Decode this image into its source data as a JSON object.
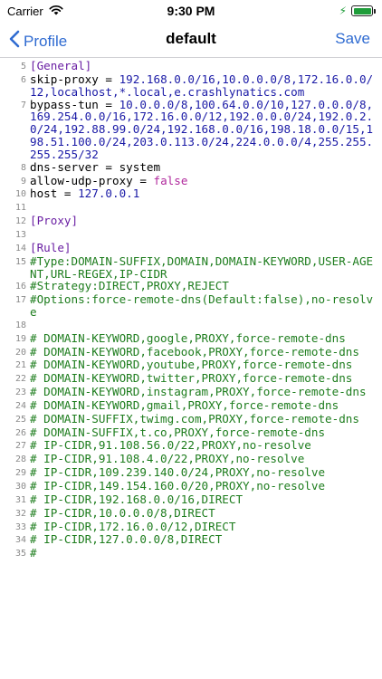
{
  "status_bar": {
    "carrier": "Carrier",
    "time": "9:30 PM",
    "battery_level": 1.0
  },
  "nav": {
    "back_label": "Profile",
    "title": "default",
    "save_label": "Save"
  },
  "colors": {
    "accent": "#2f6bd1",
    "section": "#6a1fa3",
    "value": "#1a1aa6",
    "boolean": "#b0289c",
    "comment": "#1e7d1e",
    "line_number": "#8a8a8a"
  },
  "lines": [
    {
      "num": "5",
      "type": "section",
      "text": "[General]"
    },
    {
      "num": "6",
      "type": "kv",
      "key": "skip-proxy = ",
      "value": "192.168.0.0/16,10.0.0.0/8,172.16.0.0/12,localhost,*.local,e.crashlynatics.com",
      "value_type": "value"
    },
    {
      "num": "7",
      "type": "kv",
      "key": "bypass-tun = ",
      "value": "10.0.0.0/8,100.64.0.0/10,127.0.0.0/8,169.254.0.0/16,172.16.0.0/12,192.0.0.0/24,192.0.2.0/24,192.88.99.0/24,192.168.0.0/16,198.18.0.0/15,198.51.100.0/24,203.0.113.0/24,224.0.0.0/4,255.255.255.255/32",
      "value_type": "value"
    },
    {
      "num": "8",
      "type": "kv",
      "key": "dns-server = system",
      "value": "",
      "value_type": "value"
    },
    {
      "num": "9",
      "type": "kv",
      "key": "allow-udp-proxy = ",
      "value": "false",
      "value_type": "boolean"
    },
    {
      "num": "10",
      "type": "kv",
      "key": "host = ",
      "value": "127.0.0.1",
      "value_type": "value"
    },
    {
      "num": "11",
      "type": "blank",
      "text": ""
    },
    {
      "num": "12",
      "type": "section",
      "text": "[Proxy]"
    },
    {
      "num": "13",
      "type": "blank",
      "text": ""
    },
    {
      "num": "14",
      "type": "section",
      "text": "[Rule]"
    },
    {
      "num": "15",
      "type": "comment",
      "text": "#Type:DOMAIN-SUFFIX,DOMAIN,DOMAIN-KEYWORD,USER-AGENT,URL-REGEX,IP-CIDR"
    },
    {
      "num": "16",
      "type": "comment",
      "text": "#Strategy:DIRECT,PROXY,REJECT"
    },
    {
      "num": "17",
      "type": "comment",
      "text": "#Options:force-remote-dns(Default:false),no-resolve"
    },
    {
      "num": "18",
      "type": "blank",
      "text": ""
    },
    {
      "num": "19",
      "type": "comment",
      "text": "# DOMAIN-KEYWORD,google,PROXY,force-remote-dns"
    },
    {
      "num": "20",
      "type": "comment",
      "text": "# DOMAIN-KEYWORD,facebook,PROXY,force-remote-dns"
    },
    {
      "num": "21",
      "type": "comment",
      "text": "# DOMAIN-KEYWORD,youtube,PROXY,force-remote-dns"
    },
    {
      "num": "22",
      "type": "comment",
      "text": "# DOMAIN-KEYWORD,twitter,PROXY,force-remote-dns"
    },
    {
      "num": "23",
      "type": "comment",
      "text": "# DOMAIN-KEYWORD,instagram,PROXY,force-remote-dns"
    },
    {
      "num": "24",
      "type": "comment",
      "text": "# DOMAIN-KEYWORD,gmail,PROXY,force-remote-dns"
    },
    {
      "num": "25",
      "type": "comment",
      "text": "# DOMAIN-SUFFIX,twimg.com,PROXY,force-remote-dns"
    },
    {
      "num": "26",
      "type": "comment",
      "text": "# DOMAIN-SUFFIX,t.co,PROXY,force-remote-dns"
    },
    {
      "num": "27",
      "type": "comment",
      "text": "# IP-CIDR,91.108.56.0/22,PROXY,no-resolve"
    },
    {
      "num": "28",
      "type": "comment",
      "text": "# IP-CIDR,91.108.4.0/22,PROXY,no-resolve"
    },
    {
      "num": "29",
      "type": "comment",
      "text": "# IP-CIDR,109.239.140.0/24,PROXY,no-resolve"
    },
    {
      "num": "30",
      "type": "comment",
      "text": "# IP-CIDR,149.154.160.0/20,PROXY,no-resolve"
    },
    {
      "num": "31",
      "type": "comment",
      "text": "# IP-CIDR,192.168.0.0/16,DIRECT"
    },
    {
      "num": "32",
      "type": "comment",
      "text": "# IP-CIDR,10.0.0.0/8,DIRECT"
    },
    {
      "num": "33",
      "type": "comment",
      "text": "# IP-CIDR,172.16.0.0/12,DIRECT"
    },
    {
      "num": "34",
      "type": "comment",
      "text": "# IP-CIDR,127.0.0.0/8,DIRECT"
    },
    {
      "num": "35",
      "type": "comment",
      "text": "#"
    }
  ]
}
